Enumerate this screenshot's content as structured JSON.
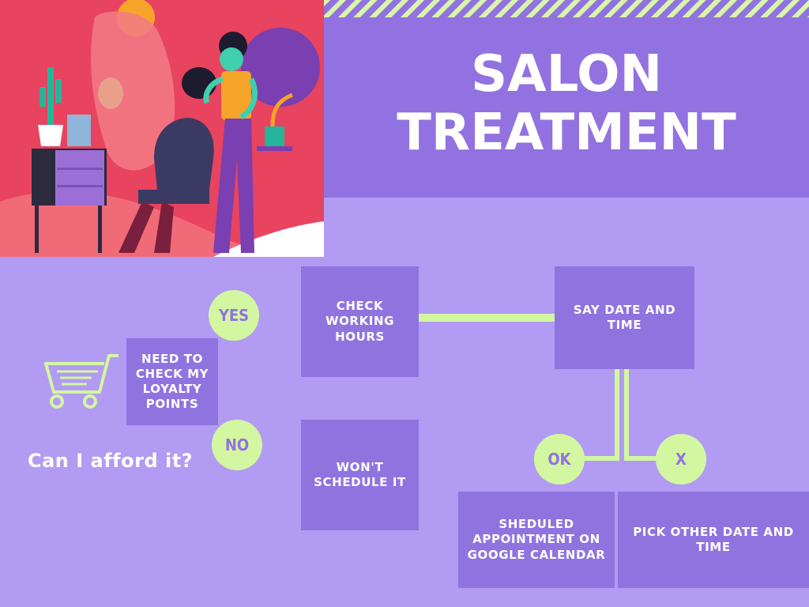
{
  "title": {
    "line1": "SALON",
    "line2": "TREATMENT"
  },
  "start": {
    "question": "Can I afford it?",
    "icon": "shopping-cart-icon"
  },
  "nodes": {
    "loyalty": "NEED TO CHECK MY LOYALTY POINTS",
    "check_hours": "CHECK WORKING HOURS",
    "wont_schedule": "WON'T SCHEDULE IT",
    "say_date": "SAY DATE AND TIME",
    "scheduled": "SHEDULED APPOINTMENT ON GOOGLE CALENDAR",
    "pick_other": "PICK OTHER DATE AND TIME"
  },
  "decisions": {
    "yes": "YES",
    "no": "NO",
    "ok": "OK",
    "x": "X"
  },
  "colors": {
    "header": "#9172e0",
    "background": "#b29bf2",
    "box": "#8f74e0",
    "accent": "#d3f7a0",
    "illustration_bg": "#e8435f"
  }
}
